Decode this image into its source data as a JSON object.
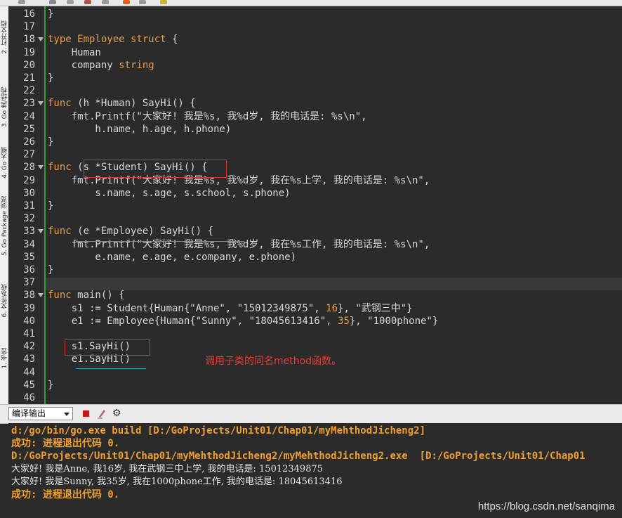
{
  "sidebar_tabs": [
    "1. 书签",
    "2. 打开文档",
    "3. Go 类/结构",
    "4. Go 大纲",
    "5. Go Package 浏览",
    "6. 文件系统"
  ],
  "editor": {
    "lines": [
      {
        "n": "16",
        "tokens": [
          {
            "t": "}",
            "c": "p"
          }
        ]
      },
      {
        "n": "17",
        "tokens": []
      },
      {
        "n": "18",
        "tokens": [
          {
            "t": "type ",
            "c": "kw"
          },
          {
            "t": "Employee ",
            "c": "ty"
          },
          {
            "t": "struct",
            "c": "kw"
          },
          {
            "t": " {",
            "c": "p"
          }
        ]
      },
      {
        "n": "19",
        "tokens": [
          {
            "t": "    Human",
            "c": "p"
          }
        ]
      },
      {
        "n": "20",
        "tokens": [
          {
            "t": "    company ",
            "c": "p"
          },
          {
            "t": "string",
            "c": "ty"
          }
        ]
      },
      {
        "n": "21",
        "tokens": [
          {
            "t": "}",
            "c": "p"
          }
        ]
      },
      {
        "n": "22",
        "tokens": []
      },
      {
        "n": "23",
        "tokens": [
          {
            "t": "func",
            "c": "kw"
          },
          {
            "t": " (h *Human) SayHi() {",
            "c": "p"
          }
        ]
      },
      {
        "n": "24",
        "tokens": [
          {
            "t": "    fmt.Printf(\"大家好! 我是%s, 我%d岁, 我的电话是: %s\\n\",",
            "c": "p"
          }
        ]
      },
      {
        "n": "25",
        "tokens": [
          {
            "t": "        h.name, h.age, h.phone)",
            "c": "p"
          }
        ]
      },
      {
        "n": "26",
        "tokens": [
          {
            "t": "}",
            "c": "p"
          }
        ]
      },
      {
        "n": "27",
        "tokens": []
      },
      {
        "n": "28",
        "tokens": [
          {
            "t": "func",
            "c": "kw"
          },
          {
            "t": " (s *Student) SayHi() {",
            "c": "p"
          }
        ]
      },
      {
        "n": "29",
        "tokens": [
          {
            "t": "    fmt.Printf(\"大家好! 我是%s, 我%d岁, 我在%s上学, 我的电话是: %s\\n\",",
            "c": "p"
          }
        ]
      },
      {
        "n": "30",
        "tokens": [
          {
            "t": "        s.name, s.age, s.school, s.phone)",
            "c": "p"
          }
        ]
      },
      {
        "n": "31",
        "tokens": [
          {
            "t": "}",
            "c": "p"
          }
        ]
      },
      {
        "n": "32",
        "tokens": []
      },
      {
        "n": "33",
        "tokens": [
          {
            "t": "func",
            "c": "kw"
          },
          {
            "t": " (e *Employee) SayHi() {",
            "c": "p"
          }
        ]
      },
      {
        "n": "34",
        "tokens": [
          {
            "t": "    fmt.Printf(\"大家好! 我是%s, 我%d岁, 我在%s工作, 我的电话是: %s\\n\",",
            "c": "p"
          }
        ]
      },
      {
        "n": "35",
        "tokens": [
          {
            "t": "        e.name, e.age, e.company, e.phone)",
            "c": "p"
          }
        ]
      },
      {
        "n": "36",
        "tokens": [
          {
            "t": "}",
            "c": "p"
          }
        ]
      },
      {
        "n": "37",
        "tokens": []
      },
      {
        "n": "38",
        "tokens": [
          {
            "t": "func",
            "c": "kw"
          },
          {
            "t": " main() {",
            "c": "p"
          }
        ]
      },
      {
        "n": "39",
        "tokens": [
          {
            "t": "    s1 := Student{Human{\"Anne\", \"15012349875\", ",
            "c": "p"
          },
          {
            "t": "16",
            "c": "ty"
          },
          {
            "t": "}, \"武钢三中\"}",
            "c": "p"
          }
        ]
      },
      {
        "n": "40",
        "tokens": [
          {
            "t": "    e1 := Employee{Human{\"Sunny\", \"18045613416\", ",
            "c": "p"
          },
          {
            "t": "35",
            "c": "ty"
          },
          {
            "t": "}, \"1000phone\"}",
            "c": "p"
          }
        ]
      },
      {
        "n": "41",
        "tokens": []
      },
      {
        "n": "42",
        "tokens": [
          {
            "t": "    s1.SayHi()",
            "c": "p"
          }
        ]
      },
      {
        "n": "43",
        "tokens": [
          {
            "t": "    e1.SayHi()",
            "c": "p"
          }
        ]
      },
      {
        "n": "44",
        "tokens": []
      },
      {
        "n": "45",
        "tokens": [
          {
            "t": "}",
            "c": "p"
          }
        ]
      },
      {
        "n": "46",
        "tokens": []
      }
    ],
    "annotation": "调用子类的同名method函数。"
  },
  "output_panel": {
    "selector_value": "编译输出",
    "lines": [
      {
        "text": "d:/go/bin/go.exe build [D:/GoProjects/Unit01/Chap01/myMehthodJicheng2]",
        "style": "orange"
      },
      {
        "text": "成功: 进程退出代码 0.",
        "style": "orange"
      },
      {
        "text": "D:/GoProjects/Unit01/Chap01/myMehthodJicheng2/myMehthodJicheng2.exe  [D:/GoProjects/Unit01/Chap01",
        "style": "orange"
      },
      {
        "text": "大家好! 我是Anne, 我16岁, 我在武钢三中上学, 我的电话是: 15012349875",
        "style": "white"
      },
      {
        "text": "大家好! 我是Sunny, 我35岁, 我在1000phone工作, 我的电话是: 18045613416",
        "style": "white"
      },
      {
        "text": "成功: 进程退出代码 0.",
        "style": "orange"
      }
    ]
  },
  "watermark": "https://blog.csdn.net/sanqima",
  "colors": {
    "keyword": "#e8a04a",
    "background": "#2b2b2b",
    "highlight_box": "#e03030",
    "underline": "#1fb0b0",
    "annotation": "#e83a3a"
  },
  "icons": [
    "stop-icon",
    "clear-icon",
    "gear-icon",
    "chevron-down-icon"
  ]
}
